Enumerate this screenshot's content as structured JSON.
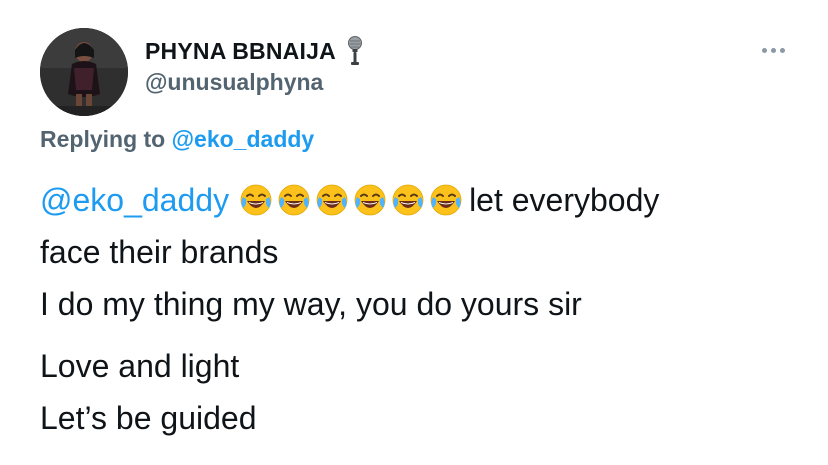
{
  "author": {
    "display_name": "PHYNA BBNAIJA",
    "handle": "@unusualphyna",
    "badge_icon": "microphone-icon",
    "avatar_icon": "profile-photo"
  },
  "menu": {
    "icon": "more-horizontal-icon"
  },
  "reply": {
    "prefix": "Replying to",
    "mention": "@eko_daddy"
  },
  "tweet": {
    "mention": "@eko_daddy",
    "emoji_name": "face-with-tears-of-joy",
    "emoji_count": 6,
    "line1_text": "let everybody",
    "line2": "face their brands",
    "line3": "I do my thing my way, you do yours sir",
    "line4": "Love and light",
    "line5": "Let’s be guided"
  },
  "colors": {
    "link": "#1d9bf0",
    "secondary_text": "#536471",
    "primary_text": "#0f1419"
  }
}
